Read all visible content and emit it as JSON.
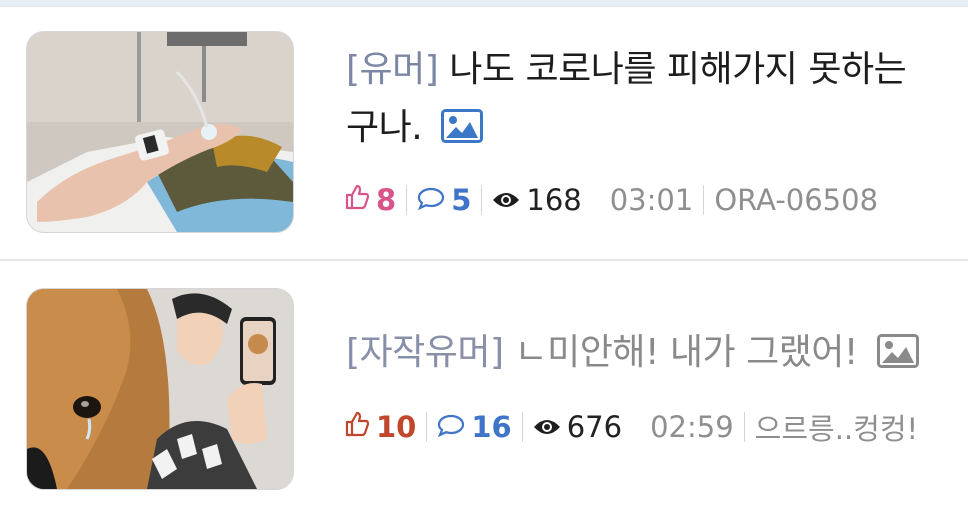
{
  "posts": [
    {
      "category": "[유머]",
      "title": "나도 코로나를 피해가지 못하는 구나.",
      "likes": "8",
      "comments": "5",
      "views": "168",
      "time": "03:01",
      "author": "ORA-06508",
      "thumbnail_icon": "hospital-arm-photo",
      "has_image_icon": "image-icon"
    },
    {
      "category": "[자작유머]",
      "title": "ㄴ미안해! 내가 그랬어!",
      "likes": "10",
      "comments": "16",
      "views": "676",
      "time": "02:59",
      "author": "으르릉..컹컹!",
      "thumbnail_icon": "crying-dog-photo",
      "has_image_icon": "image-icon"
    }
  ],
  "colors": {
    "category_tag": "#7b87a3",
    "likes_pink": "#d9548a",
    "likes_red": "#c0462c",
    "comments_blue": "#3f74c9",
    "meta_gray": "#8f8f8f"
  }
}
